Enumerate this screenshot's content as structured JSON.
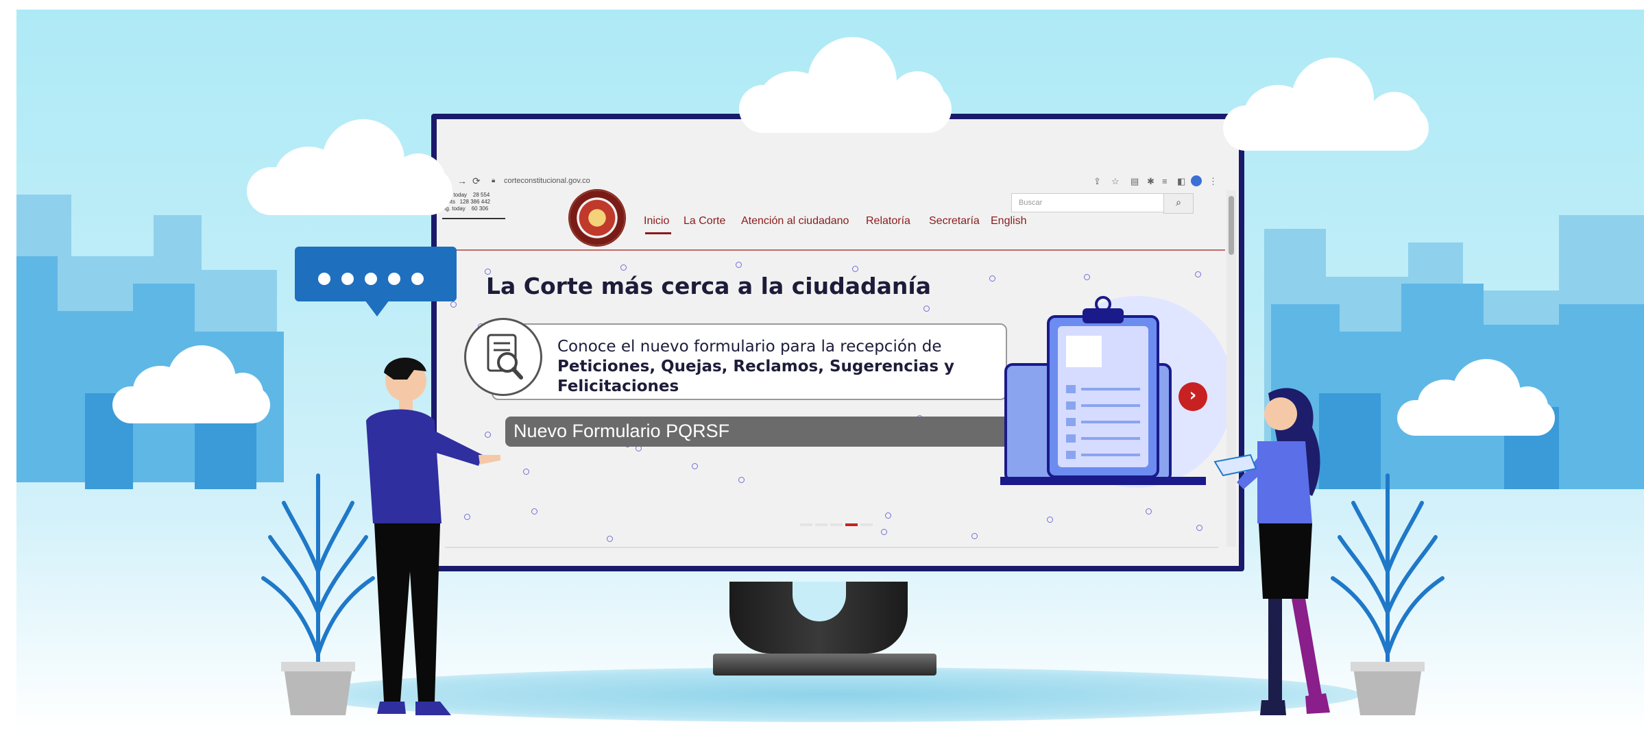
{
  "browser": {
    "url": "corteconstitucional.gov.co"
  },
  "visitor_stats": {
    "lines": [
      "Hoy today    28 554",
      "Visits   128 386 442",
      "Ag. today    60 306"
    ]
  },
  "site_header": {
    "nav_items": [
      "Inicio",
      "La Corte",
      "Atención al ciudadano",
      "Relatoría",
      "Secretaría",
      "English"
    ],
    "active_item": "Inicio",
    "search_placeholder": "Buscar"
  },
  "hero": {
    "title": "La Corte más cerca a la ciudadanía",
    "card_text": "Conoce el nuevo formulario para la recepción de",
    "card_bold": "Peticiones, Quejas, Reclamos, Sugerencias y Felicitaciones",
    "button_label": "Nuevo Formulario PQRSF"
  },
  "carousel": {
    "slides": 5,
    "active_slide": 4
  },
  "colors": {
    "sky": "#aeeaf6",
    "monitor_frame": "#1a1a6b",
    "brand_red": "#8b1a1a",
    "accent_blue": "#1f6fbf",
    "next_button": "#c82121"
  },
  "icons": [
    "search-icon",
    "back-arrow-icon",
    "forward-arrow-icon",
    "reload-icon",
    "lock-icon",
    "star-icon",
    "share-icon",
    "extensions-icon",
    "profile-icon",
    "menu-dots-icon",
    "document-search-icon",
    "clipboard-icon",
    "chevron-right-icon"
  ]
}
